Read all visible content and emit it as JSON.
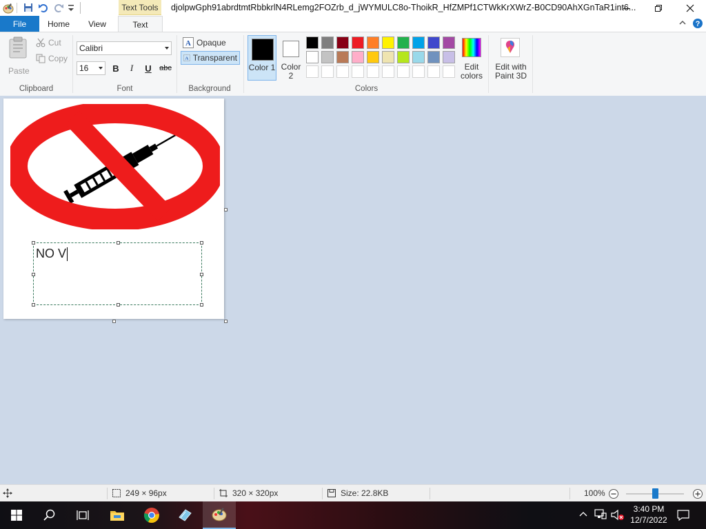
{
  "window": {
    "title": "djolpwGph91abrdtmtRbbkrlN4RLemg2FOZrb_d_jWYMULC8o-ThoikR_HfZMPf1CTWkKrXWrZ-B0CD90AhXGnTaR1int6...",
    "context_tab": "Text Tools"
  },
  "tabs": {
    "file": "File",
    "home": "Home",
    "view": "View",
    "text": "Text"
  },
  "clipboard": {
    "paste": "Paste",
    "cut": "Cut",
    "copy": "Copy",
    "label": "Clipboard"
  },
  "font": {
    "family": "Calibri",
    "size": "16",
    "bold": "B",
    "italic": "I",
    "underline": "U",
    "strike": "abc",
    "label": "Font"
  },
  "background": {
    "opaque": "Opaque",
    "transparent": "Transparent",
    "label": "Background"
  },
  "colors": {
    "color1": "Color 1",
    "color2": "Color 2",
    "label": "Colors",
    "edit_colors": "Edit colors",
    "edit_paint3d": "Edit with Paint 3D",
    "row1": [
      "#000000",
      "#7f7f7f",
      "#880015",
      "#ed1c24",
      "#ff7f27",
      "#fff200",
      "#22b14c",
      "#00a2e8",
      "#3f48cc",
      "#a349a4"
    ],
    "row2": [
      "#ffffff",
      "#c3c3c3",
      "#b97a57",
      "#ffaec9",
      "#ffc90e",
      "#efe4b0",
      "#b5e61d",
      "#99d9ea",
      "#7092be",
      "#c8bfe7"
    ]
  },
  "canvas": {
    "text_content": "NO V"
  },
  "status": {
    "selection": "249 × 96px",
    "image_size": "320 × 320px",
    "file_size": "Size: 22.8KB",
    "zoom": "100%"
  },
  "taskbar": {
    "time": "3:40 PM",
    "date": "12/7/2022"
  }
}
